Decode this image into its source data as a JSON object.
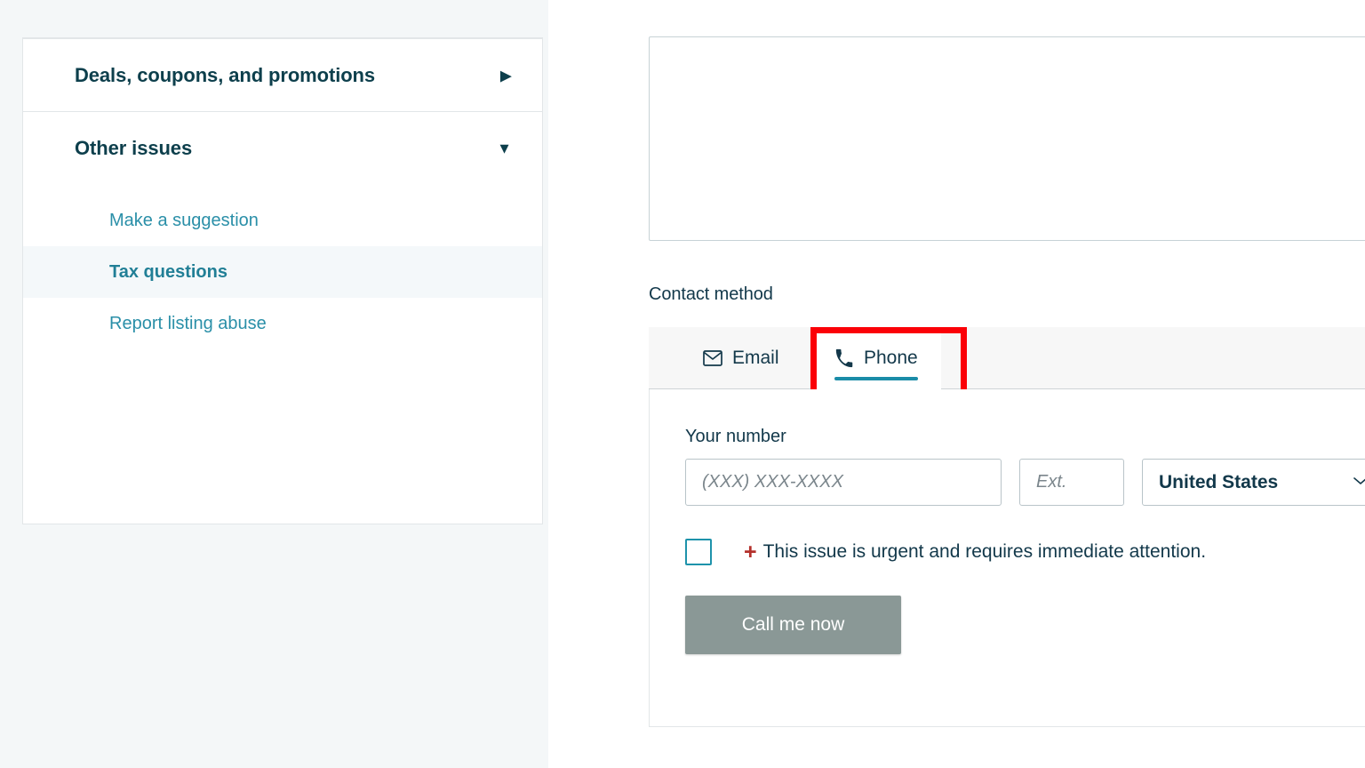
{
  "sidebar": {
    "accordions": [
      {
        "label": "Deals, coupons, and promotions",
        "arrow": "▶",
        "arrow_icon": "chevron-right-icon",
        "expanded": false
      },
      {
        "label": "Other issues",
        "arrow": "▼",
        "arrow_icon": "chevron-down-icon",
        "expanded": true
      }
    ],
    "other_issues_items": [
      {
        "label": "Make a suggestion",
        "selected": false
      },
      {
        "label": "Tax questions",
        "selected": true
      },
      {
        "label": "Report listing abuse",
        "selected": false
      }
    ]
  },
  "main": {
    "description_textarea": {
      "value": "",
      "placeholder": ""
    },
    "contact_method_label": "Contact method",
    "tabs": [
      {
        "label": "Email",
        "icon": "envelope-icon",
        "active": false
      },
      {
        "label": "Phone",
        "icon": "phone-icon",
        "active": true
      }
    ],
    "phone_panel": {
      "number_label": "Your number",
      "number_value": "",
      "number_placeholder": "(XXX) XXX-XXXX",
      "ext_value": "",
      "ext_placeholder": "Ext.",
      "country_selected": "United States",
      "country_chevron": "⌄",
      "urgent_plus": "+",
      "urgent_label": "This issue is urgent and requires immediate attention.",
      "urgent_checked": false,
      "submit_label": "Call me now"
    }
  },
  "colors": {
    "page_background": "#f4f7f8",
    "accent_teal": "#1a8ca8",
    "link_teal": "#2a8fa8",
    "heading_navy": "#0d3f4c",
    "highlight_red": "#fb0007",
    "urgent_red": "#b4302b",
    "disabled_button": "#8a9896"
  }
}
